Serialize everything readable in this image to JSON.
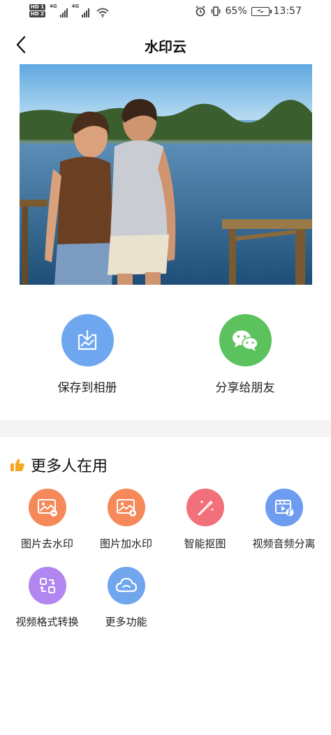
{
  "status_bar": {
    "hd1": "HD 1",
    "hd2": "HD 2",
    "net1": "4G",
    "net2": "4G",
    "battery_pct": "65%",
    "time": "13:57"
  },
  "header": {
    "title": "水印云"
  },
  "actions": {
    "save_label": "保存到相册",
    "share_label": "分享给朋友"
  },
  "more": {
    "title": "更多人在用",
    "tools": [
      {
        "label": "图片去水印",
        "color": "#f5895a"
      },
      {
        "label": "图片加水印",
        "color": "#f5895a"
      },
      {
        "label": "智能抠图",
        "color": "#f2707a"
      },
      {
        "label": "视频音频分离",
        "color": "#6d9cf0"
      },
      {
        "label": "视频格式转换",
        "color": "#b286f0"
      },
      {
        "label": "更多功能",
        "color": "#6fa6ee"
      }
    ]
  },
  "colors": {
    "save_circle": "#6ea6f0",
    "share_circle": "#5cc25e",
    "thumb_icon": "#f5a623"
  }
}
